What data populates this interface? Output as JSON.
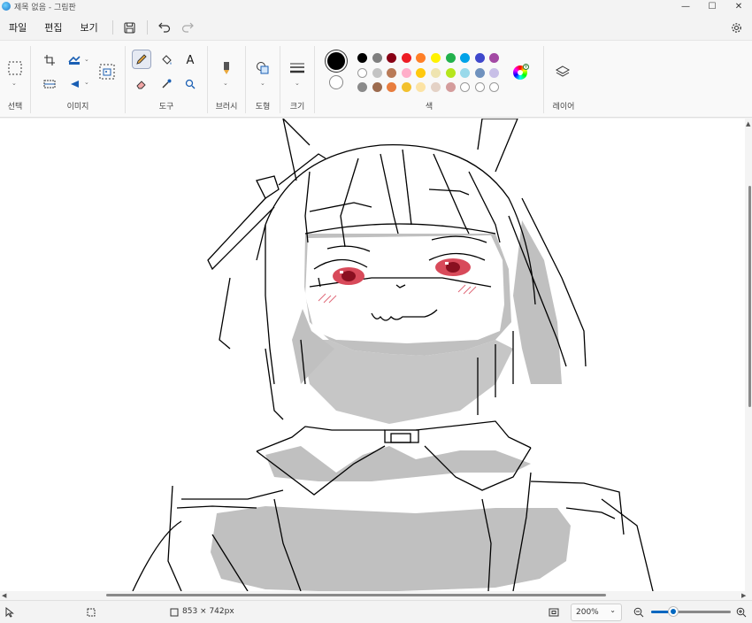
{
  "titlebar": {
    "title": "제목 없음 - 그림판",
    "minimize": "—",
    "maximize": "☐",
    "close": "✕"
  },
  "menu": {
    "file": "파일",
    "edit": "편집",
    "view": "보기"
  },
  "ribbon": {
    "select_label": "선택",
    "image_label": "이미지",
    "tools_label": "도구",
    "brushes_label": "브러시",
    "shapes_label": "도형",
    "size_label": "크기",
    "colors_label": "색",
    "layers_label": "레이어"
  },
  "palette": {
    "row1": [
      "#000000",
      "#7f7f7f",
      "#880015",
      "#ed1c24",
      "#ff7f27",
      "#fff200",
      "#22b14c",
      "#00a2e8",
      "#3f48cc",
      "#a349a4"
    ],
    "row2": [
      "#ffffff",
      "#c3c3c3",
      "#b97a57",
      "#ffaec9",
      "#ffc90e",
      "#efe4b0",
      "#b5e61d",
      "#99d9ea",
      "#7092be",
      "#c8bfe7"
    ],
    "row3": [
      "#8a8a8a",
      "#9c6b4e",
      "#e87d3e",
      "#f2c12e",
      "#fce3a4",
      "#e4d2c6",
      "#d49c9c",
      "outline",
      "outline",
      "outline"
    ],
    "primary": "#000000",
    "secondary": "#ffffff"
  },
  "status": {
    "canvas_size": "853 × 742px",
    "zoom": "200%"
  }
}
